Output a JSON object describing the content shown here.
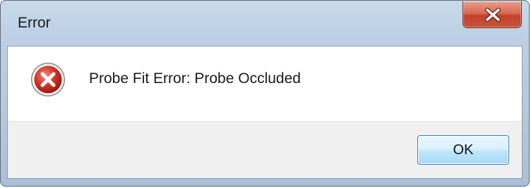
{
  "window": {
    "title": "Error",
    "close_icon": "close-x-icon"
  },
  "dialog": {
    "icon": "error-icon",
    "message": "Probe Fit Error: Probe Occluded",
    "ok_label": "OK"
  },
  "colors": {
    "close_button": "#c8553a",
    "error_icon": "#c9302c",
    "ok_border": "#3c7fb1"
  }
}
